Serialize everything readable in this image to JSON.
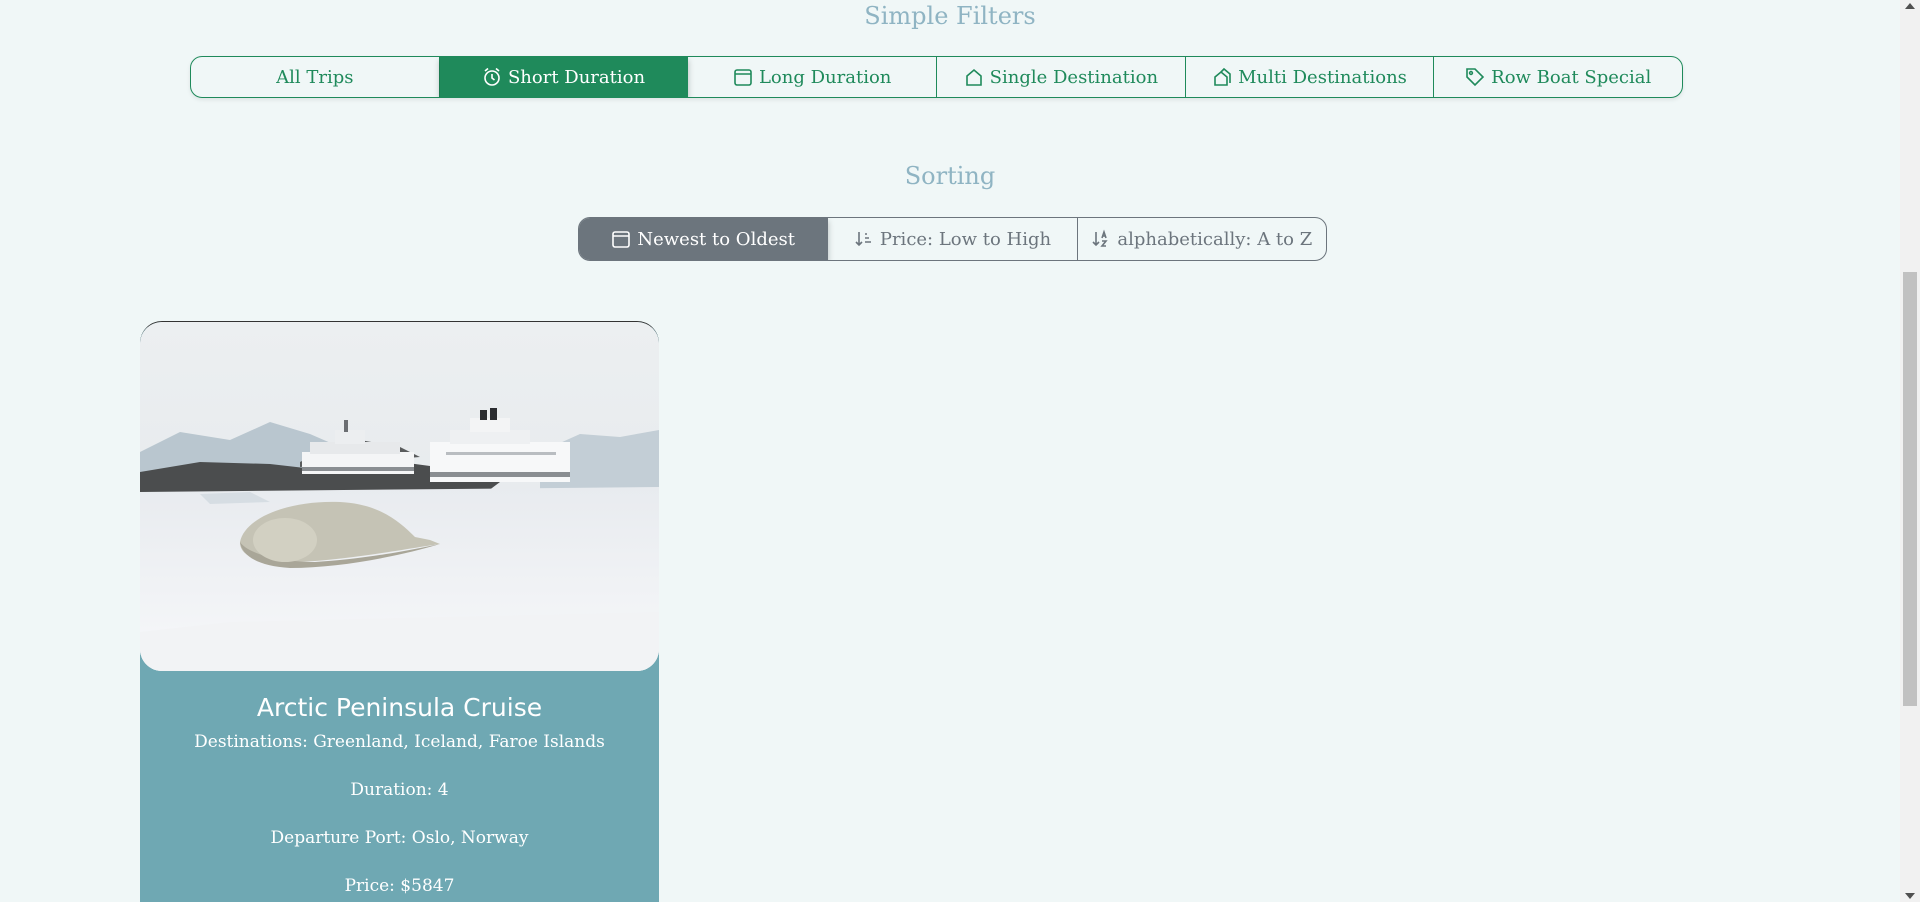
{
  "filters": {
    "title": "Simple Filters",
    "items": [
      {
        "label": "All Trips",
        "icon": "none",
        "active": false
      },
      {
        "label": "Short Duration",
        "icon": "alarm-clock-icon",
        "active": true
      },
      {
        "label": "Long Duration",
        "icon": "calendar-icon",
        "active": false
      },
      {
        "label": "Single Destination",
        "icon": "house-icon",
        "active": false
      },
      {
        "label": "Multi Destinations",
        "icon": "houses-icon",
        "active": false
      },
      {
        "label": "Row Boat Special",
        "icon": "tag-icon",
        "active": false
      }
    ],
    "accent_color": "#1f8a5b"
  },
  "sorting": {
    "title": "Sorting",
    "items": [
      {
        "label": "Newest to Oldest",
        "icon": "calendar-icon",
        "active": true
      },
      {
        "label": "Price: Low to High",
        "icon": "sort-numeric-icon",
        "active": false
      },
      {
        "label": "alphabetically: A to Z",
        "icon": "sort-alpha-icon",
        "active": false
      }
    ],
    "accent_color": "#6c757d"
  },
  "trips": [
    {
      "title": "Arctic Peninsula Cruise",
      "destinations": "Destinations: Greenland, Iceland, Faroe Islands",
      "duration": "Duration: 4",
      "departure_port": "Departure Port: Oslo, Norway",
      "price": "Price: $5847",
      "card_color": "#6fa8b3"
    }
  ]
}
